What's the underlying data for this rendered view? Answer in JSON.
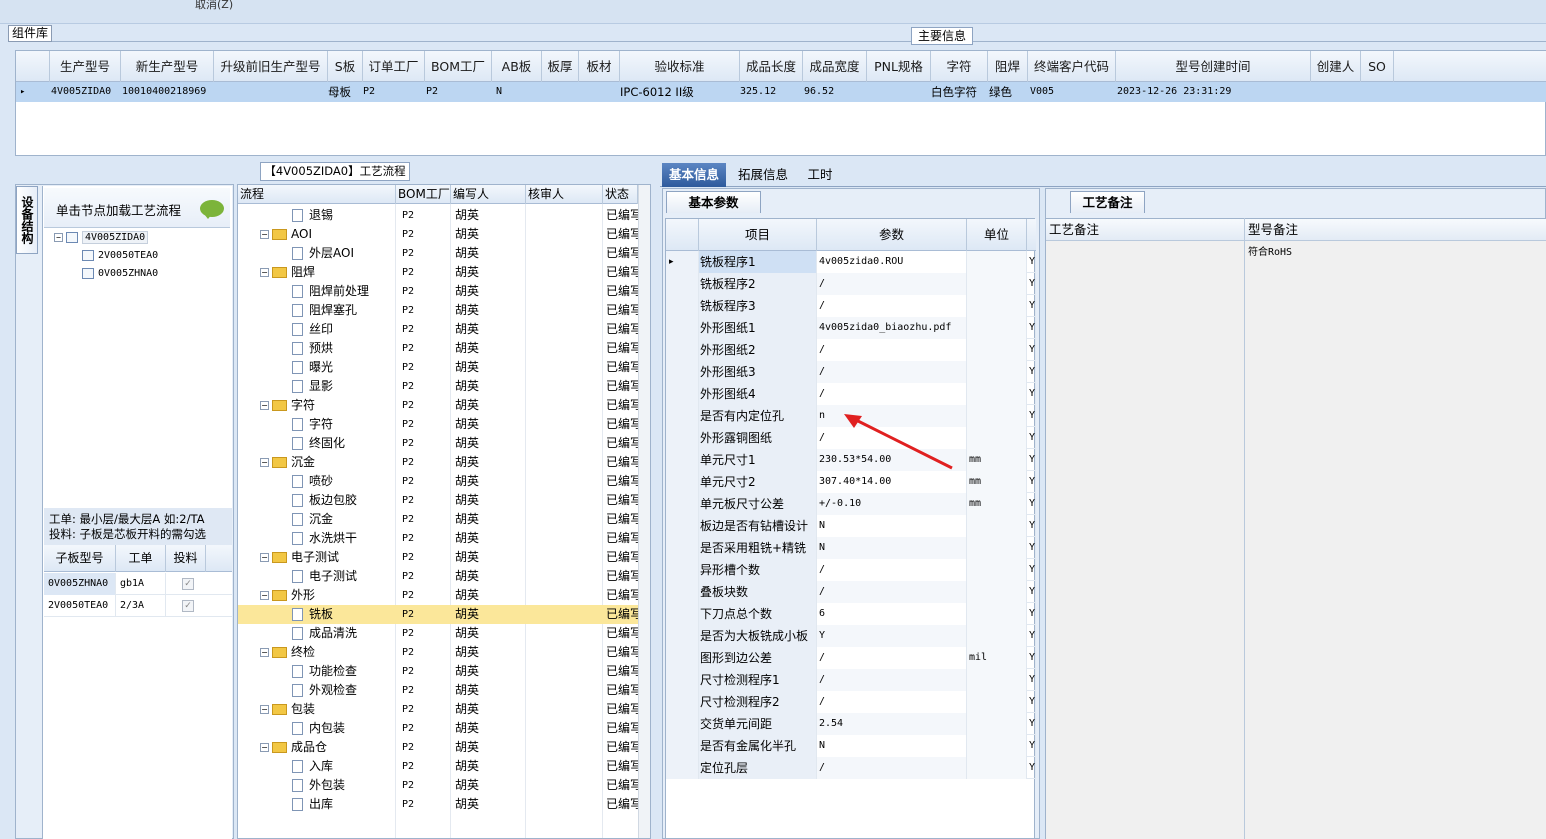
{
  "top": {
    "cut_label": "取消(Z)",
    "lib_label": "组件库",
    "main_info": "主要信息"
  },
  "grid1": {
    "headers": [
      "生产型号",
      "新生产型号",
      "升级前旧生产型号",
      "S板",
      "订单工厂",
      "BOM工厂",
      "AB板",
      "板厚",
      "板材",
      "验收标准",
      "成品长度",
      "成品宽度",
      "PNL规格",
      "字符",
      "阻焊",
      "终端客户代码",
      "型号创建时间",
      "创建人",
      "SO"
    ],
    "row": {
      "model": "4V005ZIDA0",
      "new_model": "10010400218969",
      "s_board": "母板",
      "order_factory": "P2",
      "bom_factory": "P2",
      "ab": "N",
      "standard": "IPC-6012 II级",
      "length": "325.12",
      "width": "96.52",
      "char": "白色字符",
      "mask": "绿色",
      "customer": "V005",
      "created": "2023-12-26 23:31:29"
    }
  },
  "flow_title": "【4V005ZIDA0】工艺流程",
  "left": {
    "vtab": "设备结构",
    "hint": "单击节点加载工艺流程",
    "tree": [
      "4V005ZIDA0",
      "2V0050TEA0",
      "0V005ZHNA0"
    ],
    "info1": "工单: 最小层/最大层A 如:2/TA",
    "info2": "投料: 子板是芯板开料的需勾选",
    "sub_headers": [
      "子板型号",
      "工单",
      "投料"
    ],
    "sub_rows": [
      {
        "model": "0V005ZHNA0",
        "order": "gb1A"
      },
      {
        "model": "2V0050TEA0",
        "order": "2/3A"
      }
    ]
  },
  "flow": {
    "headers": [
      "流程",
      "BOM工厂",
      "编写人",
      "核审人",
      "状态"
    ],
    "rows": [
      {
        "name": "退锡",
        "bom": "P2",
        "writer": "胡英",
        "status": "已编写"
      },
      {
        "name": "AOI",
        "bom": "P2",
        "writer": "胡英",
        "status": "已编写"
      },
      {
        "name": "外层AOI",
        "bom": "P2",
        "writer": "胡英",
        "status": "已编写"
      },
      {
        "name": "阻焊",
        "bom": "P2",
        "writer": "胡英",
        "status": "已编写"
      },
      {
        "name": "阻焊前处理",
        "bom": "P2",
        "writer": "胡英",
        "status": "已编写"
      },
      {
        "name": "阻焊塞孔",
        "bom": "P2",
        "writer": "胡英",
        "status": "已编写"
      },
      {
        "name": "丝印",
        "bom": "P2",
        "writer": "胡英",
        "status": "已编写"
      },
      {
        "name": "预烘",
        "bom": "P2",
        "writer": "胡英",
        "status": "已编写"
      },
      {
        "name": "曝光",
        "bom": "P2",
        "writer": "胡英",
        "status": "已编写"
      },
      {
        "name": "显影",
        "bom": "P2",
        "writer": "胡英",
        "status": "已编写"
      },
      {
        "name": "字符",
        "bom": "P2",
        "writer": "胡英",
        "status": "已编写"
      },
      {
        "name": "字符",
        "bom": "P2",
        "writer": "胡英",
        "status": "已编写"
      },
      {
        "name": "终固化",
        "bom": "P2",
        "writer": "胡英",
        "status": "已编写"
      },
      {
        "name": "沉金",
        "bom": "P2",
        "writer": "胡英",
        "status": "已编写"
      },
      {
        "name": "喷砂",
        "bom": "P2",
        "writer": "胡英",
        "status": "已编写"
      },
      {
        "name": "板边包胶",
        "bom": "P2",
        "writer": "胡英",
        "status": "已编写"
      },
      {
        "name": "沉金",
        "bom": "P2",
        "writer": "胡英",
        "status": "已编写"
      },
      {
        "name": "水洗烘干",
        "bom": "P2",
        "writer": "胡英",
        "status": "已编写"
      },
      {
        "name": "电子测试",
        "bom": "P2",
        "writer": "胡英",
        "status": "已编写"
      },
      {
        "name": "电子测试",
        "bom": "P2",
        "writer": "胡英",
        "status": "已编写"
      },
      {
        "name": "外形",
        "bom": "P2",
        "writer": "胡英",
        "status": "已编写"
      },
      {
        "name": "铣板",
        "bom": "P2",
        "writer": "胡英",
        "status": "已编写"
      },
      {
        "name": "成品清洗",
        "bom": "P2",
        "writer": "胡英",
        "status": "已编写"
      },
      {
        "name": "终检",
        "bom": "P2",
        "writer": "胡英",
        "status": "已编写"
      },
      {
        "name": "功能检查",
        "bom": "P2",
        "writer": "胡英",
        "status": "已编写"
      },
      {
        "name": "外观检查",
        "bom": "P2",
        "writer": "胡英",
        "status": "已编写"
      },
      {
        "name": "包装",
        "bom": "P2",
        "writer": "胡英",
        "status": "已编写"
      },
      {
        "name": "内包装",
        "bom": "P2",
        "writer": "胡英",
        "status": "已编写"
      },
      {
        "name": "成品仓",
        "bom": "P2",
        "writer": "胡英",
        "status": "已编写"
      },
      {
        "name": "入库",
        "bom": "P2",
        "writer": "胡英",
        "status": "已编写"
      },
      {
        "name": "外包装",
        "bom": "P2",
        "writer": "胡英",
        "status": "已编写"
      },
      {
        "name": "出库",
        "bom": "P2",
        "writer": "胡英",
        "status": "已编写"
      }
    ]
  },
  "tabs": [
    "基本信息",
    "拓展信息",
    "工时"
  ],
  "params": {
    "subtab": "基本参数",
    "headers": [
      "项目",
      "参数",
      "单位"
    ],
    "rows": [
      {
        "item": "铣板程序1",
        "value": "4v005zida0.ROU",
        "unit": "",
        "flag": "Y"
      },
      {
        "item": "铣板程序2",
        "value": "/",
        "unit": "",
        "flag": "Y"
      },
      {
        "item": "铣板程序3",
        "value": "/",
        "unit": "",
        "flag": "Y"
      },
      {
        "item": "外形图纸1",
        "value": "4v005zida0_biaozhu.pdf",
        "unit": "",
        "flag": "Y"
      },
      {
        "item": "外形图纸2",
        "value": "/",
        "unit": "",
        "flag": "Y"
      },
      {
        "item": "外形图纸3",
        "value": "/",
        "unit": "",
        "flag": "Y"
      },
      {
        "item": "外形图纸4",
        "value": "/",
        "unit": "",
        "flag": "Y"
      },
      {
        "item": "是否有内定位孔",
        "value": "n",
        "unit": "",
        "flag": "Y"
      },
      {
        "item": "外形露铜图纸",
        "value": "/",
        "unit": "",
        "flag": "Y"
      },
      {
        "item": "单元尺寸1",
        "value": "230.53*54.00",
        "unit": "mm",
        "flag": "Y"
      },
      {
        "item": "单元尺寸2",
        "value": "307.40*14.00",
        "unit": "mm",
        "flag": "Y"
      },
      {
        "item": "单元板尺寸公差",
        "value": "+/-0.10",
        "unit": "mm",
        "flag": "Y"
      },
      {
        "item": "板边是否有钻槽设计",
        "value": "N",
        "unit": "",
        "flag": "Y"
      },
      {
        "item": "是否采用粗铣+精铣",
        "value": "N",
        "unit": "",
        "flag": "Y"
      },
      {
        "item": "异形槽个数",
        "value": "/",
        "unit": "",
        "flag": "Y"
      },
      {
        "item": "叠板块数",
        "value": "/",
        "unit": "",
        "flag": "Y"
      },
      {
        "item": "下刀点总个数",
        "value": "6",
        "unit": "",
        "flag": "Y"
      },
      {
        "item": "是否为大板铣成小板",
        "value": "Y",
        "unit": "",
        "flag": "Y"
      },
      {
        "item": "图形到边公差",
        "value": "/",
        "unit": "mil",
        "flag": "Y"
      },
      {
        "item": "尺寸检测程序1",
        "value": "/",
        "unit": "",
        "flag": "Y"
      },
      {
        "item": "尺寸检测程序2",
        "value": "/",
        "unit": "",
        "flag": "Y"
      },
      {
        "item": "交货单元间距",
        "value": "2.54",
        "unit": "",
        "flag": "Y"
      },
      {
        "item": "是否有金属化半孔",
        "value": "N",
        "unit": "",
        "flag": "Y"
      },
      {
        "item": "定位孔层",
        "value": "/",
        "unit": "",
        "flag": "Y"
      }
    ]
  },
  "notes": {
    "tab": "工艺备注",
    "col1": "工艺备注",
    "col2": "型号备注",
    "remark": "符合RoHS"
  },
  "colors": {
    "accent": "#2d5a9c",
    "selected_row": "#fbe79a",
    "grid_selected": "#bcd6f2",
    "arrow": "#e02020"
  }
}
